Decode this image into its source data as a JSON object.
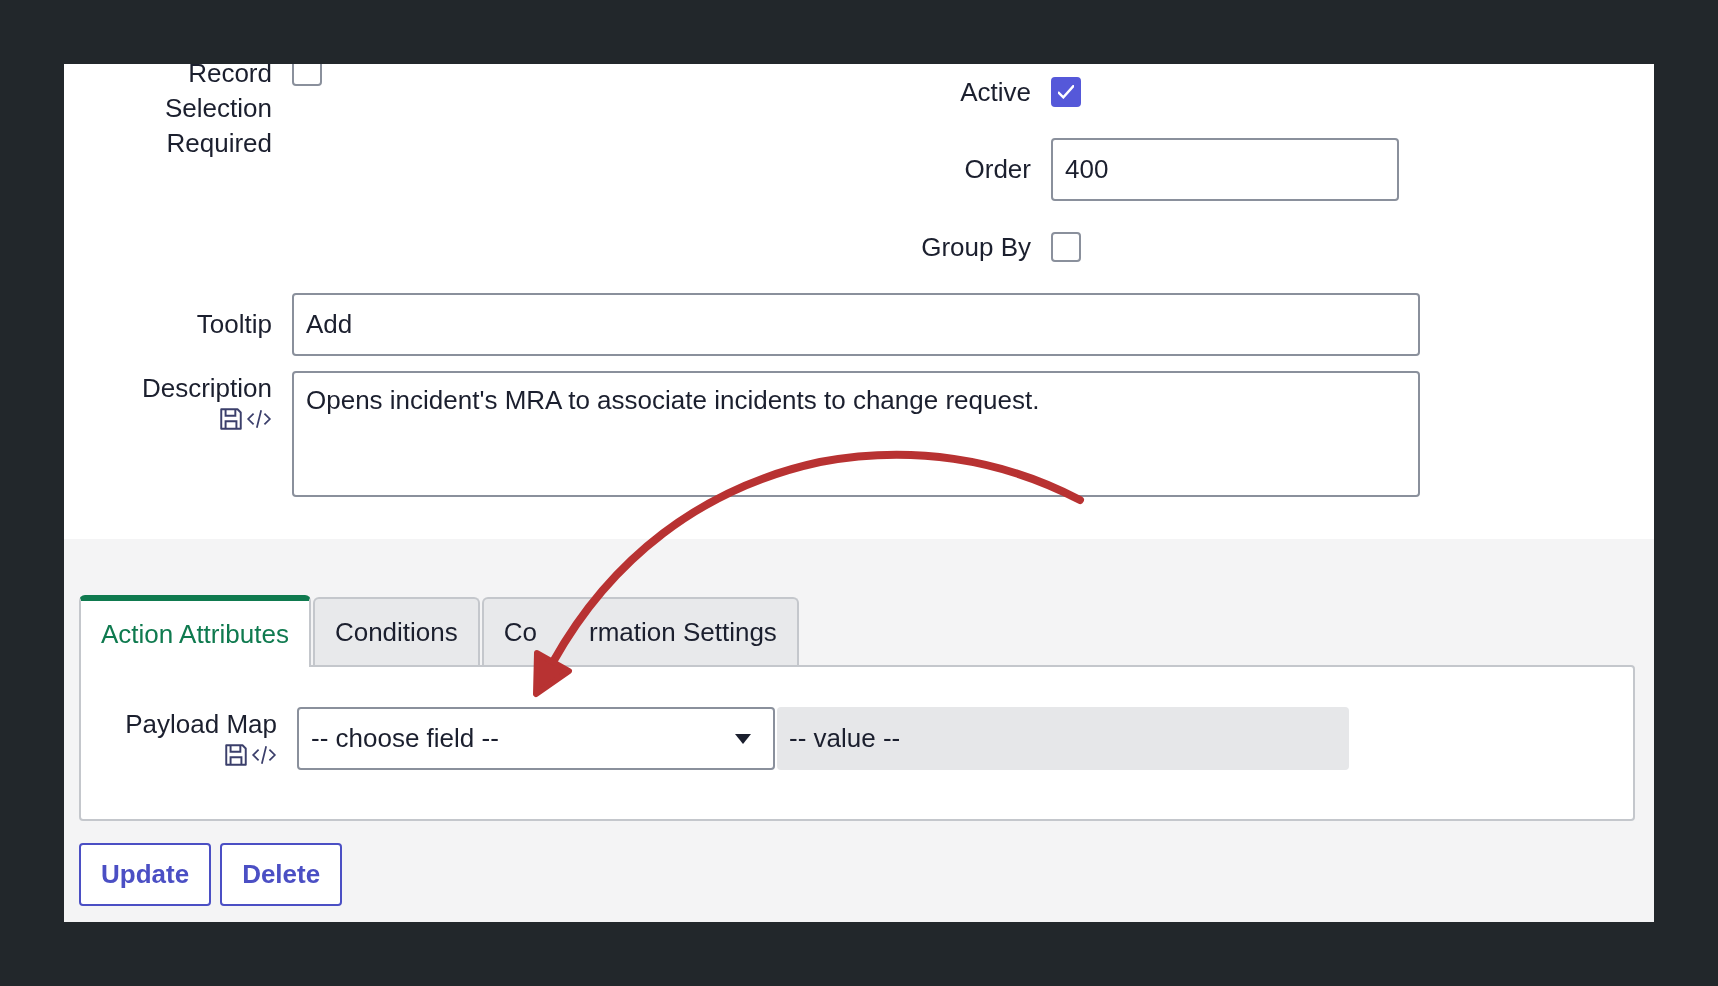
{
  "form": {
    "left_fields": [
      {
        "kind": "checkbox",
        "label": "Record Selection Required",
        "checked": false
      }
    ],
    "right_fields": [
      {
        "kind": "checkbox",
        "label": "Active",
        "checked": true
      },
      {
        "kind": "text",
        "label": "Order",
        "value": "400"
      },
      {
        "kind": "checkbox",
        "label": "Group By",
        "checked": false
      }
    ],
    "wide_fields": [
      {
        "kind": "text",
        "label": "Tooltip",
        "value": "Add"
      },
      {
        "kind": "textarea",
        "label": "Description",
        "value": "Opens incident's MRA to associate incidents to change request."
      }
    ]
  },
  "tabs": [
    {
      "label": "Action Attributes",
      "selected": true
    },
    {
      "label": "Conditions",
      "selected": false
    },
    {
      "label_parts": [
        "Co",
        "rmation Settings"
      ],
      "selected": false
    }
  ],
  "payload_map": {
    "label": "Payload Map",
    "select": "-- choose field --",
    "value_placeholder": "-- value --"
  },
  "buttons": [
    "Update",
    "Delete"
  ]
}
